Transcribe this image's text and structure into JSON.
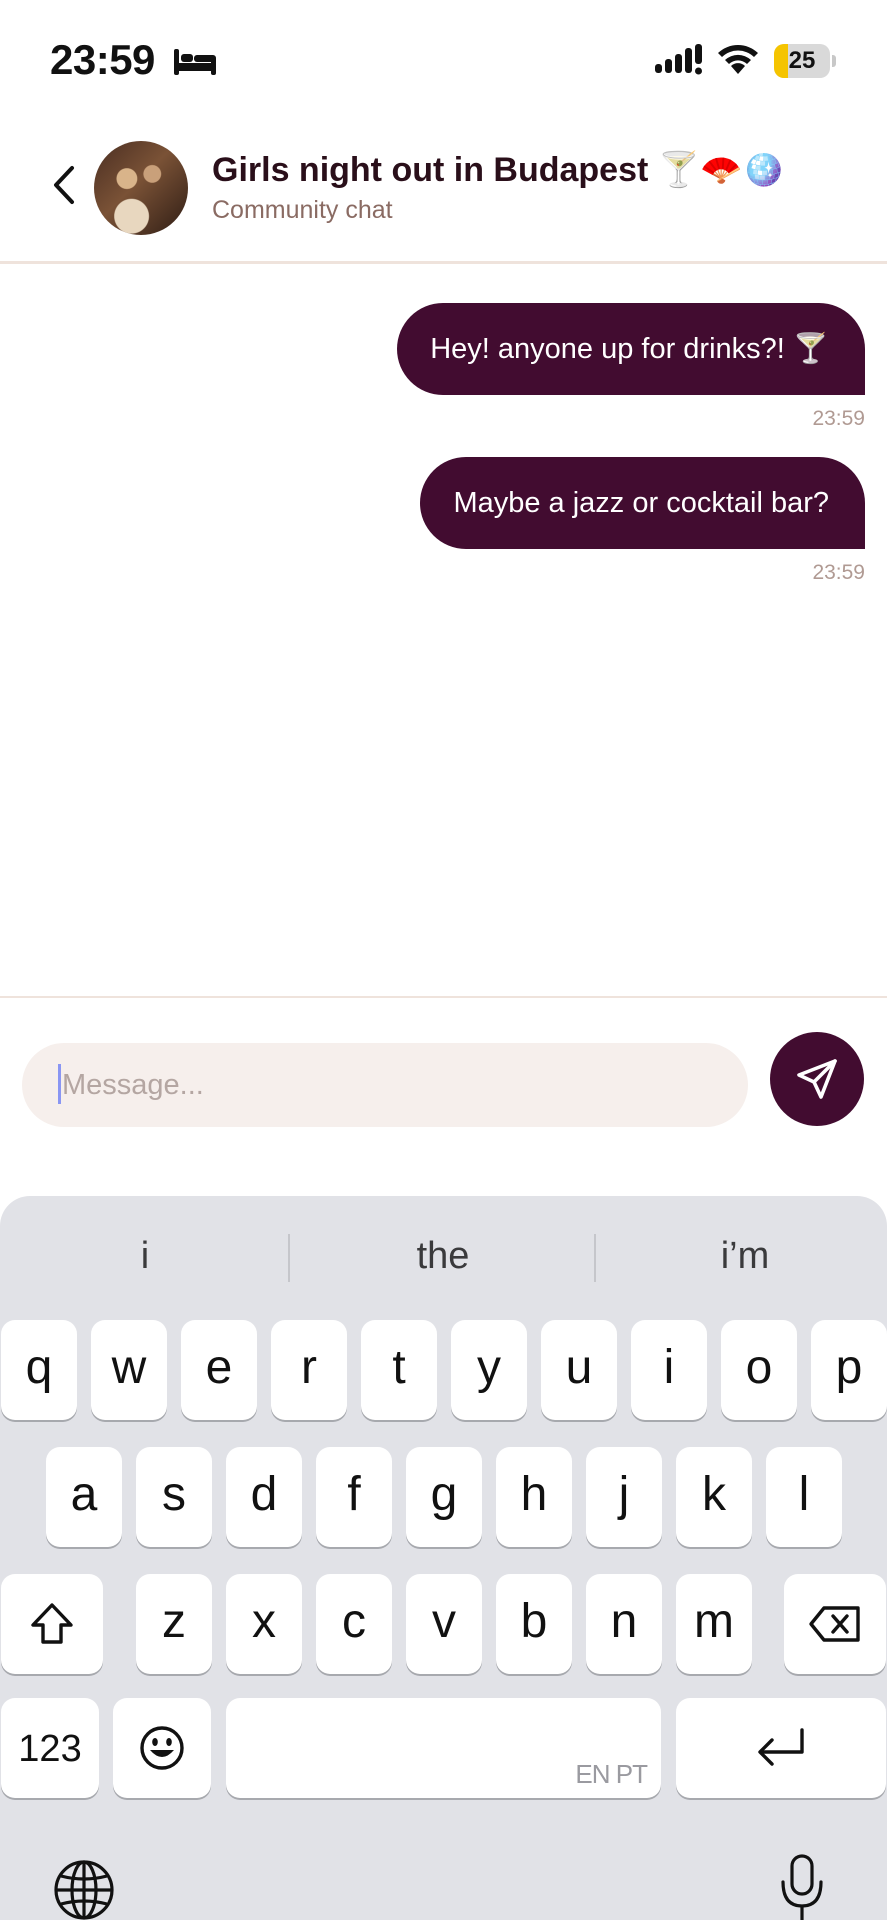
{
  "status_bar": {
    "time": "23:59",
    "battery_level": "25",
    "battery_fraction": 0.25,
    "battery_color": "#f5c400",
    "icons": [
      "bed-icon",
      "signal-icon",
      "wifi-icon",
      "battery-icon"
    ]
  },
  "header": {
    "title": "Girls night out in Budapest 🍸🪭🪩",
    "subtitle": "Community chat",
    "back_icon": "chevron-left-icon"
  },
  "messages": [
    {
      "text": "Hey! anyone up for drinks?! 🍸",
      "time": "23:59"
    },
    {
      "text": "Maybe a jazz or cocktail bar?",
      "time": "23:59"
    }
  ],
  "composer": {
    "placeholder": "Message...",
    "value": "",
    "send_icon": "send-icon"
  },
  "keyboard": {
    "suggestions": [
      "i",
      "the",
      "i’m"
    ],
    "row1": [
      "q",
      "w",
      "e",
      "r",
      "t",
      "y",
      "u",
      "i",
      "o",
      "p"
    ],
    "row2": [
      "a",
      "s",
      "d",
      "f",
      "g",
      "h",
      "j",
      "k",
      "l"
    ],
    "row3": [
      "z",
      "x",
      "c",
      "v",
      "b",
      "n",
      "m"
    ],
    "numbers_label": "123",
    "space_languages": "EN PT"
  },
  "colors": {
    "brand": "#420c30",
    "title": "#2a0f1a",
    "subtitle": "#8a6b63",
    "input_bg": "#f6efec",
    "keyboard_bg": "#e1e2e7"
  }
}
